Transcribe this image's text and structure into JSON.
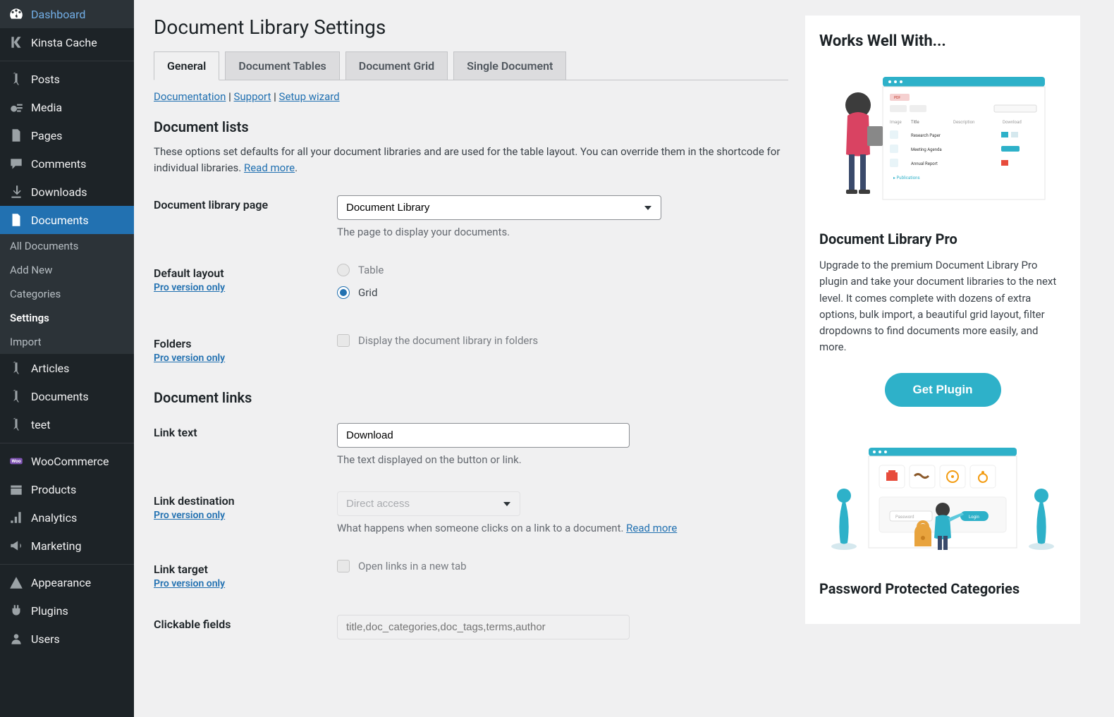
{
  "sidebar": {
    "items": [
      {
        "icon": "dashboard",
        "label": "Dashboard"
      },
      {
        "icon": "kinsta",
        "label": "Kinsta Cache"
      },
      {
        "sep": true
      },
      {
        "icon": "pin",
        "label": "Posts"
      },
      {
        "icon": "media",
        "label": "Media"
      },
      {
        "icon": "pages",
        "label": "Pages"
      },
      {
        "icon": "comments",
        "label": "Comments"
      },
      {
        "icon": "download",
        "label": "Downloads"
      },
      {
        "icon": "document",
        "label": "Documents",
        "active": true
      },
      {
        "icon": "pin",
        "label": "Articles"
      },
      {
        "icon": "pin",
        "label": "Documents"
      },
      {
        "icon": "pin",
        "label": "teet"
      },
      {
        "sep": true
      },
      {
        "icon": "woo",
        "label": "WooCommerce"
      },
      {
        "icon": "products",
        "label": "Products"
      },
      {
        "icon": "analytics",
        "label": "Analytics"
      },
      {
        "icon": "marketing",
        "label": "Marketing"
      },
      {
        "sep": true
      },
      {
        "icon": "appearance",
        "label": "Appearance"
      },
      {
        "icon": "plugins",
        "label": "Plugins"
      },
      {
        "icon": "users",
        "label": "Users"
      }
    ],
    "submenu": [
      {
        "label": "All Documents"
      },
      {
        "label": "Add New"
      },
      {
        "label": "Categories"
      },
      {
        "label": "Settings",
        "active": true
      },
      {
        "label": "Import"
      }
    ]
  },
  "page": {
    "title": "Document Library Settings",
    "tabs": [
      {
        "label": "General",
        "active": true
      },
      {
        "label": "Document Tables"
      },
      {
        "label": "Document Grid"
      },
      {
        "label": "Single Document"
      }
    ],
    "links": {
      "doc": "Documentation",
      "support": "Support",
      "wizard": "Setup wizard"
    },
    "section1": {
      "heading": "Document lists",
      "desc": "These options set defaults for all your document libraries and are used for the table layout. You can override them in the shortcode for individual libraries. ",
      "readmore": "Read more"
    },
    "fields": {
      "library_page": {
        "label": "Document library page",
        "value": "Document Library",
        "help": "The page to display your documents."
      },
      "default_layout": {
        "label": "Default layout",
        "pro": "Pro version only",
        "opt1": "Table",
        "opt2": "Grid"
      },
      "folders": {
        "label": "Folders",
        "pro": "Pro version only",
        "checkbox": "Display the document library in folders"
      },
      "section2": "Document links",
      "link_text": {
        "label": "Link text",
        "value": "Download",
        "help": "The text displayed on the button or link."
      },
      "link_dest": {
        "label": "Link destination",
        "pro": "Pro version only",
        "value": "Direct access",
        "help": "What happens when someone clicks on a link to a document. ",
        "readmore": "Read more"
      },
      "link_target": {
        "label": "Link target",
        "pro": "Pro version only",
        "checkbox": "Open links in a new tab"
      },
      "clickable": {
        "label": "Clickable fields",
        "placeholder": "title,doc_categories,doc_tags,terms,author"
      }
    }
  },
  "aside": {
    "heading": "Works Well With...",
    "promo1": {
      "title": "Document Library Pro",
      "desc": "Upgrade to the premium Document Library Pro plugin and take your document libraries to the next level. It comes complete with dozens of extra options, bulk import, a beautiful grid layout, filter dropdowns to find documents more easily, and more.",
      "button": "Get Plugin"
    },
    "promo2": {
      "title": "Password Protected Categories"
    }
  }
}
